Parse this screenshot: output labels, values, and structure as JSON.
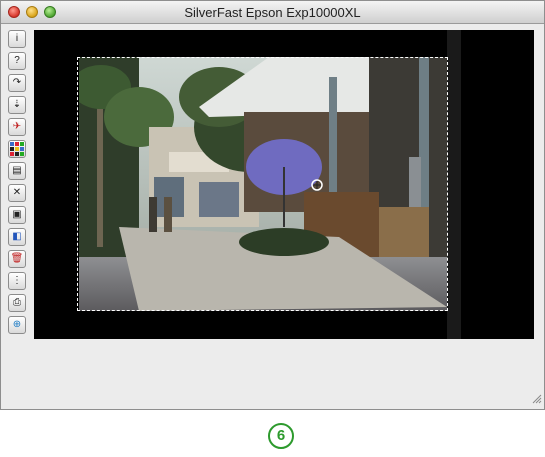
{
  "window": {
    "title": "SilverFast Epson Exp10000XL"
  },
  "toolbar": {
    "tools": [
      {
        "icon": "info-icon",
        "glyph": "i"
      },
      {
        "icon": "help-icon",
        "glyph": "?"
      },
      {
        "icon": "rotate-icon",
        "glyph": "↷"
      },
      {
        "icon": "flip-icon",
        "glyph": "⇣"
      },
      {
        "icon": "airplane-icon",
        "glyph": "✈"
      },
      {
        "icon": "grain-icon",
        "glyph": "▦"
      },
      {
        "icon": "descreen-icon",
        "glyph": "▤"
      },
      {
        "icon": "dust-icon",
        "glyph": "✕"
      },
      {
        "icon": "document-icon",
        "glyph": "▣"
      },
      {
        "icon": "frames-icon",
        "glyph": "◧"
      },
      {
        "icon": "trash-icon",
        "glyph": "🗑"
      },
      {
        "icon": "density-icon",
        "glyph": "⋮"
      },
      {
        "icon": "printer-icon",
        "glyph": "⎙"
      },
      {
        "icon": "zoom-icon",
        "glyph": "⊕"
      }
    ]
  },
  "colors": {
    "accent": "#2d9a2d",
    "preview_bg": "#000000",
    "umbrella": "#6f6bc0"
  },
  "badge": {
    "label": "6"
  }
}
